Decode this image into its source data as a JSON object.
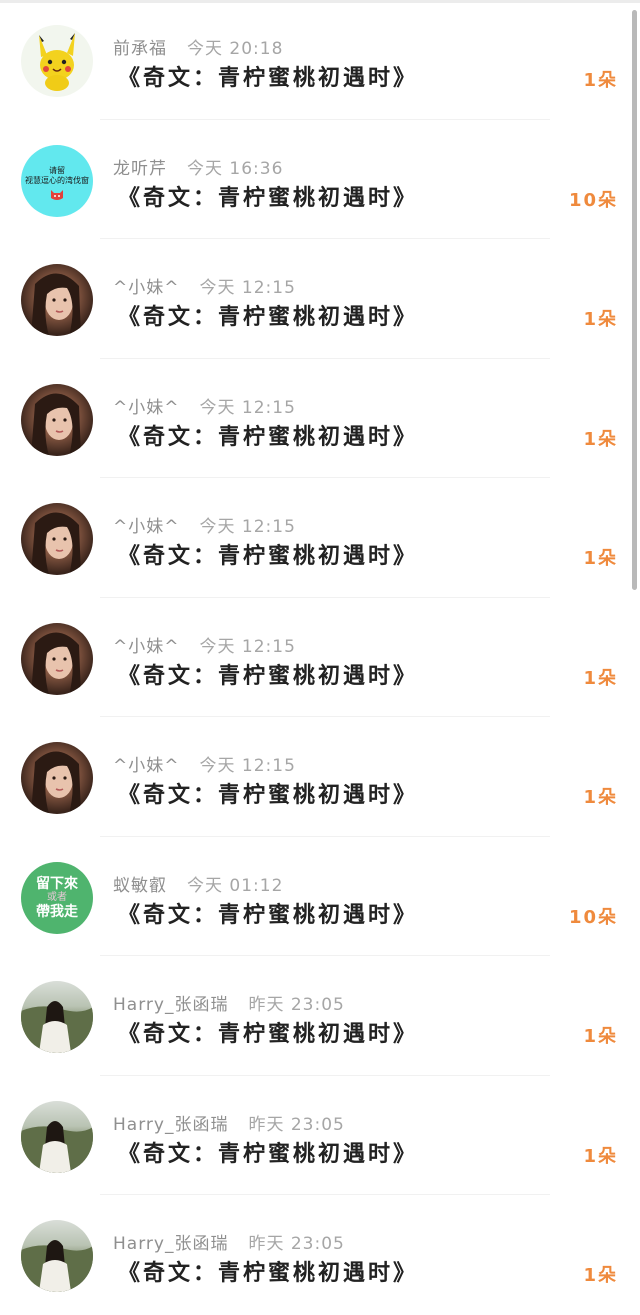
{
  "feed": {
    "items": [
      {
        "avatar": "pikachu-avatar",
        "name": "前承福",
        "time": "今天 20:18",
        "title": "《奇文：青柠蜜桃初遇时》",
        "count": "1朵"
      },
      {
        "avatar": "cyan-text-avatar",
        "avatar_text_line1": "请留",
        "avatar_text_line2": "视慧逗心的湾伐窗",
        "name": "龙听芹",
        "time": "今天 16:36",
        "title": "《奇文：青柠蜜桃初遇时》",
        "count": "10朵"
      },
      {
        "avatar": "girl-photo-avatar",
        "name": "^小妹^",
        "time": "今天 12:15",
        "title": "《奇文：青柠蜜桃初遇时》",
        "count": "1朵"
      },
      {
        "avatar": "girl-photo-avatar",
        "name": "^小妹^",
        "time": "今天 12:15",
        "title": "《奇文：青柠蜜桃初遇时》",
        "count": "1朵"
      },
      {
        "avatar": "girl-photo-avatar",
        "name": "^小妹^",
        "time": "今天 12:15",
        "title": "《奇文：青柠蜜桃初遇时》",
        "count": "1朵"
      },
      {
        "avatar": "girl-photo-avatar",
        "name": "^小妹^",
        "time": "今天 12:15",
        "title": "《奇文：青柠蜜桃初遇时》",
        "count": "1朵"
      },
      {
        "avatar": "girl-photo-avatar",
        "name": "^小妹^",
        "time": "今天 12:15",
        "title": "《奇文：青柠蜜桃初遇时》",
        "count": "1朵"
      },
      {
        "avatar": "green-text-avatar",
        "avatar_text_line1": "留下來",
        "avatar_text_line2": "或者",
        "avatar_text_line3": "帶我走",
        "name": "蚁敏叡",
        "time": "今天 01:12",
        "title": "《奇文：青柠蜜桃初遇时》",
        "count": "10朵"
      },
      {
        "avatar": "field-photo-avatar",
        "name": "Harry_张函瑞",
        "time": "昨天 23:05",
        "title": "《奇文：青柠蜜桃初遇时》",
        "count": "1朵"
      },
      {
        "avatar": "field-photo-avatar",
        "name": "Harry_张函瑞",
        "time": "昨天 23:05",
        "title": "《奇文：青柠蜜桃初遇时》",
        "count": "1朵"
      },
      {
        "avatar": "field-photo-avatar",
        "name": "Harry_张函瑞",
        "time": "昨天 23:05",
        "title": "《奇文：青柠蜜桃初遇时》",
        "count": "1朵"
      }
    ]
  },
  "colors": {
    "count": "#ef8a3d",
    "title": "#222222",
    "meta": "#8f8f8f"
  }
}
